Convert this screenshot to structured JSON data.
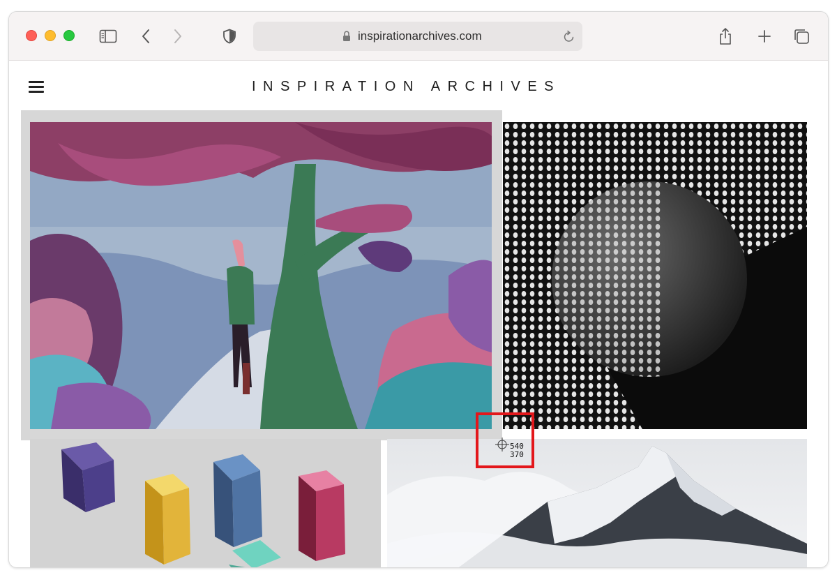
{
  "browser": {
    "url": "inspirationarchives.com",
    "icons": [
      "sidebar-icon",
      "back-icon",
      "forward-icon",
      "shield-icon",
      "lock-icon",
      "reload-icon",
      "share-icon",
      "new-tab-icon",
      "tabs-overview-icon"
    ]
  },
  "site": {
    "title": "INSPIRATION ARCHIVES",
    "menu_icon": "hamburger-icon"
  },
  "gallery": [
    {
      "name": "forest-illustration"
    },
    {
      "name": "dotted-sphere"
    },
    {
      "name": "colored-cubes"
    },
    {
      "name": "snowy-mountain"
    }
  ],
  "screenshot_tool": {
    "x_readout": "540",
    "y_readout": "370",
    "highlight_color": "#e3171b"
  }
}
